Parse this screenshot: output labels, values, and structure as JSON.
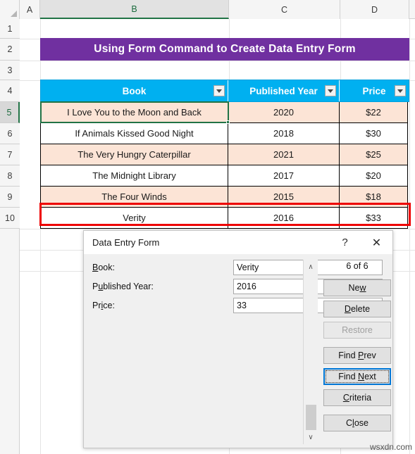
{
  "app": {
    "watermark": "wsxdn.com"
  },
  "spreadsheet": {
    "column_headers": [
      "A",
      "B",
      "C",
      "D"
    ],
    "selected_column": "B",
    "row_headers": [
      "1",
      "2",
      "3",
      "4",
      "5",
      "6",
      "7",
      "8",
      "9",
      "10"
    ],
    "selected_row": "5",
    "banner_title": "Using Form Command to Create Data Entry Form",
    "banner_color": "#7030A0",
    "table": {
      "header_color": "#00B0F0",
      "shaded_row_color": "#FCE4D6",
      "columns": [
        "Book",
        "Published Year",
        "Price"
      ],
      "rows": [
        {
          "book": "I Love You to the Moon and Back",
          "year": "2020",
          "price": "$22"
        },
        {
          "book": "If Animals Kissed Good Night",
          "year": "2018",
          "price": "$30"
        },
        {
          "book": "The Very Hungry Caterpillar",
          "year": "2021",
          "price": "$25"
        },
        {
          "book": "The Midnight Library",
          "year": "2017",
          "price": "$20"
        },
        {
          "book": "The Four Winds",
          "year": "2015",
          "price": "$18"
        },
        {
          "book": "Verity",
          "year": "2016",
          "price": "$33"
        }
      ]
    },
    "highlight_box_color": "#EE0000",
    "active_cell_color": "#217346"
  },
  "dialog": {
    "title": "Data Entry Form",
    "help_glyph": "?",
    "close_glyph": "✕",
    "record_counter": "6 of 6",
    "fields": [
      {
        "label_pre": "",
        "label_key": "B",
        "label_post": "ook:",
        "value": "Verity"
      },
      {
        "label_pre": "P",
        "label_key": "u",
        "label_post": "blished Year:",
        "value": "2016"
      },
      {
        "label_pre": "Pr",
        "label_key": "i",
        "label_post": "ce:",
        "value": "33"
      }
    ],
    "buttons": [
      {
        "pre": "Ne",
        "key": "w",
        "post": "",
        "state": "enabled"
      },
      {
        "pre": "",
        "key": "D",
        "post": "elete",
        "state": "enabled"
      },
      {
        "pre": "Restore",
        "key": "",
        "post": "",
        "state": "disabled"
      },
      {
        "pre": "Find ",
        "key": "P",
        "post": "rev",
        "state": "enabled"
      },
      {
        "pre": "Find ",
        "key": "N",
        "post": "ext",
        "state": "focused"
      },
      {
        "pre": "",
        "key": "C",
        "post": "riteria",
        "state": "enabled"
      },
      {
        "pre": "C",
        "key": "l",
        "post": "ose",
        "state": "enabled"
      }
    ],
    "scroll_up_glyph": "∧",
    "scroll_down_glyph": "∨",
    "focus_color": "#0078d7"
  }
}
